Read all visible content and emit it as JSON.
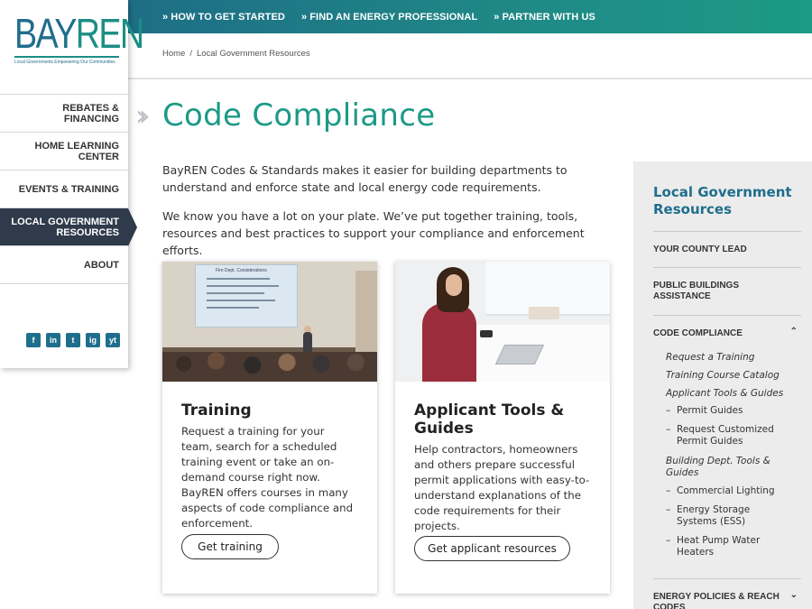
{
  "topnav": {
    "items": [
      {
        "label": "HOW TO GET STARTED"
      },
      {
        "label": "FIND AN ENERGY PROFESSIONAL"
      },
      {
        "label": "PARTNER WITH US"
      }
    ]
  },
  "logo": {
    "word_a": "BAY",
    "word_b": "REN",
    "tagline": "Local Governments Empowering Our Communities"
  },
  "sidebar": {
    "items": [
      {
        "label": "REBATES & FINANCING"
      },
      {
        "label": "HOME LEARNING CENTER"
      },
      {
        "label": "EVENTS & TRAINING"
      },
      {
        "label": "LOCAL GOVERNMENT RESOURCES"
      },
      {
        "label": "ABOUT"
      }
    ],
    "social": [
      "f",
      "in",
      "t",
      "ig",
      "yt"
    ]
  },
  "breadcrumb": {
    "home": "Home",
    "separator": "/",
    "current": "Local Government Resources"
  },
  "page": {
    "title": "Code Compliance",
    "intro1": "BayREN Codes & Standards makes it easier for building departments to understand and enforce state and local energy code requirements.",
    "intro2": "We know you have a lot on your plate. We’ve put together training, tools, resources and best practices to support your compliance and enforcement efforts."
  },
  "cards": [
    {
      "title": "Training",
      "text": "Request a training for your team, search for a scheduled training event or take an on-demand course right now. BayREN offers courses in many aspects of code compliance and enforcement.",
      "button": "Get training",
      "screen_text": "Fire Dept. Considerations"
    },
    {
      "title": "Applicant Tools & Guides",
      "text": "Help contractors, homeowners and others prepare successful permit applications with easy-to-understand explanations of the code requirements for their projects.",
      "button": "Get applicant resources"
    }
  ],
  "rightbar": {
    "title": "Local Government Resources",
    "sections": [
      {
        "label": "YOUR COUNTY LEAD"
      },
      {
        "label": "PUBLIC BUILDINGS ASSISTANCE"
      },
      {
        "label": "CODE COMPLIANCE",
        "arrow": "⌃"
      },
      {
        "label": "ENERGY POLICIES & REACH CODES",
        "arrow": "⌄"
      }
    ],
    "subs": [
      "Request a Training",
      "Training Course Catalog",
      "Applicant Tools & Guides",
      "Building Dept. Tools & Guides"
    ],
    "subsubs": [
      "Permit Guides",
      "Request Customized Permit Guides",
      "Commercial Lighting",
      "Energy Storage Systems (ESS)",
      "Heat Pump Water Heaters"
    ]
  },
  "colors": {
    "accent": "#1c9a86",
    "brand_blue": "#1f6e8c",
    "active_nav": "#2f3a4a"
  }
}
